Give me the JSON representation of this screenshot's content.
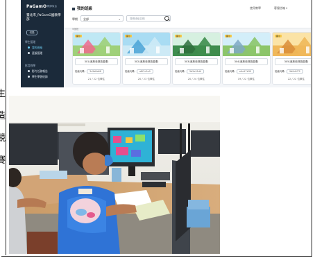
{
  "side_text": [
    "生",
    "造",
    "競",
    "賽"
  ],
  "screenshot": {
    "brand": "PaGamO",
    "brand_sub": "教師後台",
    "school": "臺北市_PaGamO國教學部",
    "sidebar_button": "切換",
    "sidebar_sections": [
      {
        "label": "學生管理",
        "items": [
          {
            "label": "我的班級",
            "active": true
          },
          {
            "label": "班級管理",
            "active": false
          }
        ]
      },
      {
        "label": "影音教學",
        "items": [
          {
            "label": "影片任務報告",
            "active": false
          },
          {
            "label": "學生學習紀錄",
            "active": false
          }
        ]
      }
    ],
    "page_title": "我的班級",
    "filter_label": "學期",
    "filter_value": "全部",
    "search_placeholder": "搜尋班級名稱",
    "top_links": [
      "使用教學",
      "客服信箱 ▾"
    ],
    "count_tag": "5個班",
    "cards": [
      {
        "tag": "國小",
        "name": "301(吳慧老師英語課)",
        "code_label": "班級代碼：",
        "code": "3c9b8a66",
        "people": "21 / 22 位學生",
        "theme": "park"
      },
      {
        "tag": "國小",
        "name": "302(吳慧老師英語課)",
        "code_label": "班級代碼：",
        "code": "a8f1c2e0",
        "people": "20 / 23 位學生",
        "theme": "city"
      },
      {
        "tag": "國小",
        "name": "303(吳慧老師英語課)",
        "code_label": "班級代碼：",
        "code": "5b2e91d4",
        "people": "20 / 24 位學生",
        "theme": "hill"
      },
      {
        "tag": "國小",
        "name": "304(吳慧老師英語課)",
        "code_label": "班級代碼：",
        "code": "e4a17b39",
        "people": "19 / 22 位學生",
        "theme": "mount"
      },
      {
        "tag": "國小",
        "name": "305(吳慧老師英語課)",
        "code_label": "班級代碼：",
        "code": "9d0c6f72",
        "people": "22 / 22 位學生",
        "theme": "desert"
      }
    ]
  }
}
